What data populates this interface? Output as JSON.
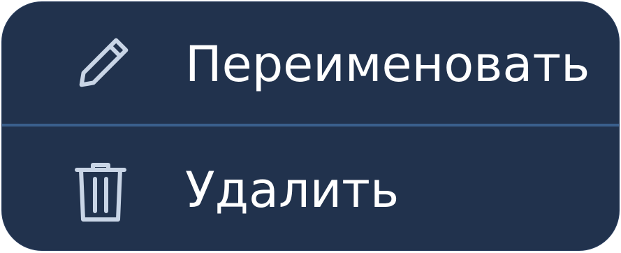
{
  "context_menu": {
    "items": [
      {
        "label": "Переименовать",
        "icon": "pencil-icon"
      },
      {
        "label": "Удалить",
        "icon": "trash-icon"
      }
    ],
    "colors": {
      "background": "#21324d",
      "divider": "#3a5f8c",
      "icon": "#c9d5e6",
      "text": "#ffffff"
    }
  }
}
